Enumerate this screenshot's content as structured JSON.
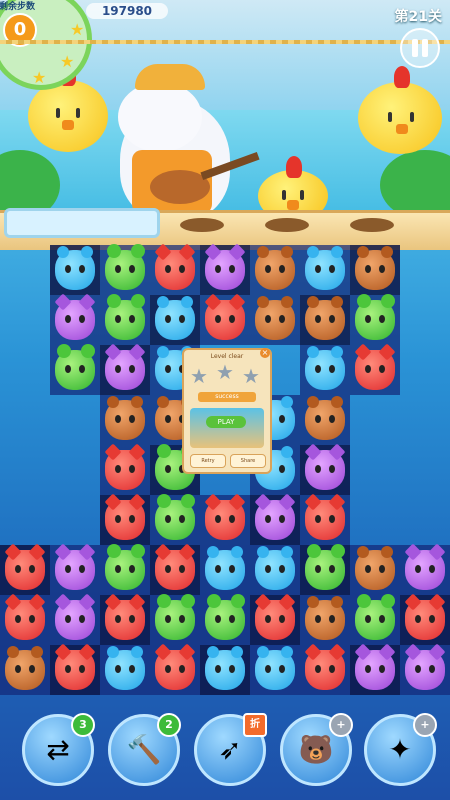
{
  "hud": {
    "moves_label": "剩余步数",
    "moves_value": "0",
    "score": "197980",
    "level": "第21关"
  },
  "board": {
    "rows": [
      [
        "blue",
        "green",
        "red",
        "purple",
        "brown",
        "blue",
        "brown"
      ],
      [
        "purple",
        "green",
        "blue",
        "red",
        "brown",
        "brown",
        "green"
      ],
      [
        "green",
        "purple",
        "blue",
        "",
        "",
        "blue",
        "red"
      ],
      [
        "",
        "brown",
        "brown",
        "",
        "blue",
        "brown",
        ""
      ],
      [
        "",
        "red",
        "green",
        "",
        "blue",
        "purple",
        ""
      ],
      [
        "",
        "red",
        "green",
        "red",
        "purple",
        "red",
        ""
      ],
      [
        "red",
        "purple",
        "green",
        "red",
        "blue",
        "blue",
        "green",
        "brown",
        "purple"
      ],
      [
        "red",
        "purple",
        "red",
        "green",
        "green",
        "red",
        "brown",
        "green",
        "red"
      ],
      [
        "brown",
        "red",
        "blue",
        "red",
        "blue",
        "blue",
        "red",
        "purple",
        "purple"
      ]
    ]
  },
  "popup": {
    "title": "Level clear",
    "banner": "success",
    "play_label": "PLAY",
    "left_button": "Retry",
    "right_button": "Share"
  },
  "tools": [
    {
      "name": "shuffle",
      "badge": "3"
    },
    {
      "name": "hammer",
      "badge": "2"
    },
    {
      "name": "swap",
      "badge": "折"
    },
    {
      "name": "bear",
      "badge": "+"
    },
    {
      "name": "combo",
      "badge": "+"
    }
  ],
  "colors": {
    "blue": "#1fa5e8",
    "green": "#2fb32c",
    "red": "#e0282b",
    "purple": "#9a43d6",
    "brown": "#b0561c"
  }
}
